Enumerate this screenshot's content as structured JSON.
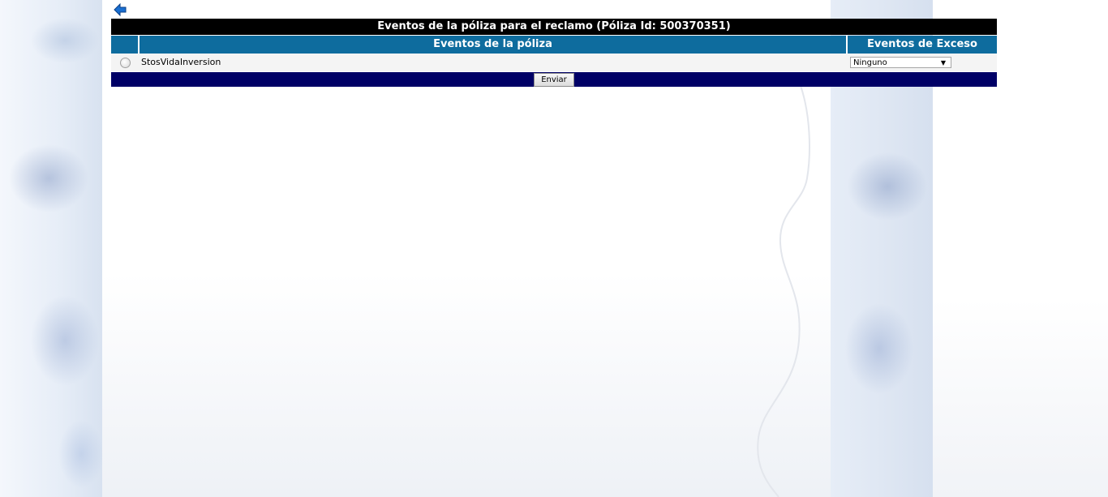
{
  "nav": {
    "back_icon": "back-arrow-icon"
  },
  "panel": {
    "title": "Eventos de la póliza para el reclamo (Póliza Id: 500370351)",
    "columns": {
      "select": "",
      "events": "Eventos de la póliza",
      "excess": "Eventos de Exceso"
    },
    "rows": [
      {
        "event_name": "StosVidaInversion",
        "selected": false,
        "excess_value": "Ninguno"
      }
    ],
    "submit_label": "Enviar"
  },
  "colors": {
    "title_bg": "#000000",
    "header_bg": "#0e6c9e",
    "footer_bg": "#000066",
    "back_icon": "#1a6fd1"
  }
}
